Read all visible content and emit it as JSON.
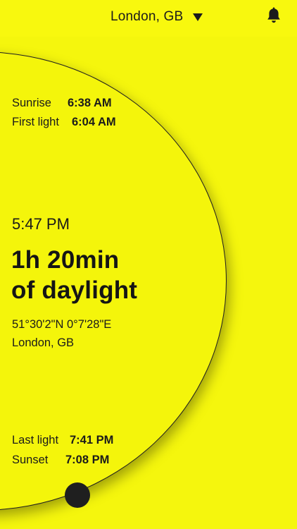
{
  "header": {
    "location": "London, GB",
    "dropdown_icon": "triangle-down-icon",
    "bell_icon": "bell-icon"
  },
  "times": {
    "sunrise_label": "Sunrise",
    "sunrise_value": "6:38 AM",
    "first_light_label": "First light",
    "first_light_value": "6:04 AM",
    "last_light_label": "Last light",
    "last_light_value": "7:41 PM",
    "sunset_label": "Sunset",
    "sunset_value": "7:08 PM"
  },
  "main": {
    "current_time": "5:47 PM",
    "daylight_amount": "1h 20min",
    "daylight_suffix": "of daylight",
    "coordinates": "51°30'2\"N  0°7'28\"E",
    "city": "London, GB"
  },
  "colors": {
    "background": "#f5f60d",
    "text": "#151515",
    "handle": "#1f1f1f"
  }
}
